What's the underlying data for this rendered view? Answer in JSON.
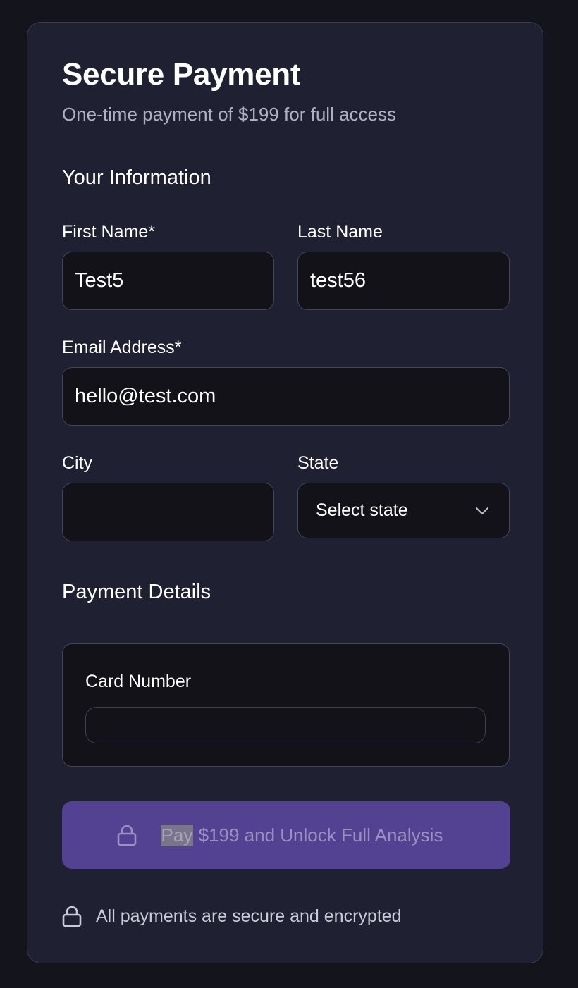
{
  "header": {
    "title": "Secure Payment",
    "subtitle": "One-time payment of $199 for full access"
  },
  "info_section": {
    "heading": "Your Information",
    "first_name": {
      "label": "First Name*",
      "value": "Test5"
    },
    "last_name": {
      "label": "Last Name",
      "value": "test56"
    },
    "email": {
      "label": "Email Address*",
      "value": "hello@test.com"
    },
    "city": {
      "label": "City",
      "value": ""
    },
    "state": {
      "label": "State",
      "selected": "Select state"
    }
  },
  "payment_section": {
    "heading": "Payment Details",
    "card_number_label": "Card Number",
    "card_number_value": ""
  },
  "pay_button": {
    "highlighted_word": "Pay",
    "rest_label": " $199 and Unlock Full Analysis",
    "icon": "lock-icon"
  },
  "footer": {
    "secure_note": "All payments are secure and encrypted",
    "icon": "lock-icon"
  },
  "colors": {
    "page_bg": "#13141c",
    "card_bg": "#1f2031",
    "input_bg": "#121218",
    "button_bg": "#524291",
    "muted_text": "#aeb1c3"
  }
}
